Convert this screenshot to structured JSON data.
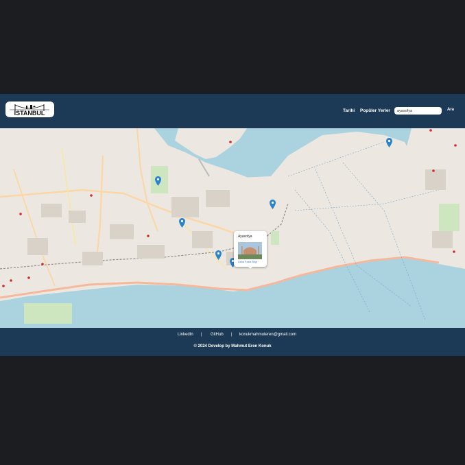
{
  "navbar": {
    "logo_text": "İSTANBUL",
    "links": [
      "Tarihi",
      "Popüler Yerler"
    ],
    "search_value": "ayasofya",
    "search_button": "Ara"
  },
  "map": {
    "popup": {
      "title": "Ayasofya",
      "link": "Daha Fazla Bilgi"
    },
    "marker_color": "#2a83cb",
    "water_color": "#aad3df"
  },
  "footer": {
    "links": [
      "LinkedIn",
      "GitHub",
      "konukmahmuteren@gmail.com"
    ],
    "separator": "|",
    "copyright": "© 2024 Develop by Mahmut Eren Konuk"
  },
  "colors": {
    "background": "#1b1d20",
    "navbar": "#1c3a56"
  }
}
